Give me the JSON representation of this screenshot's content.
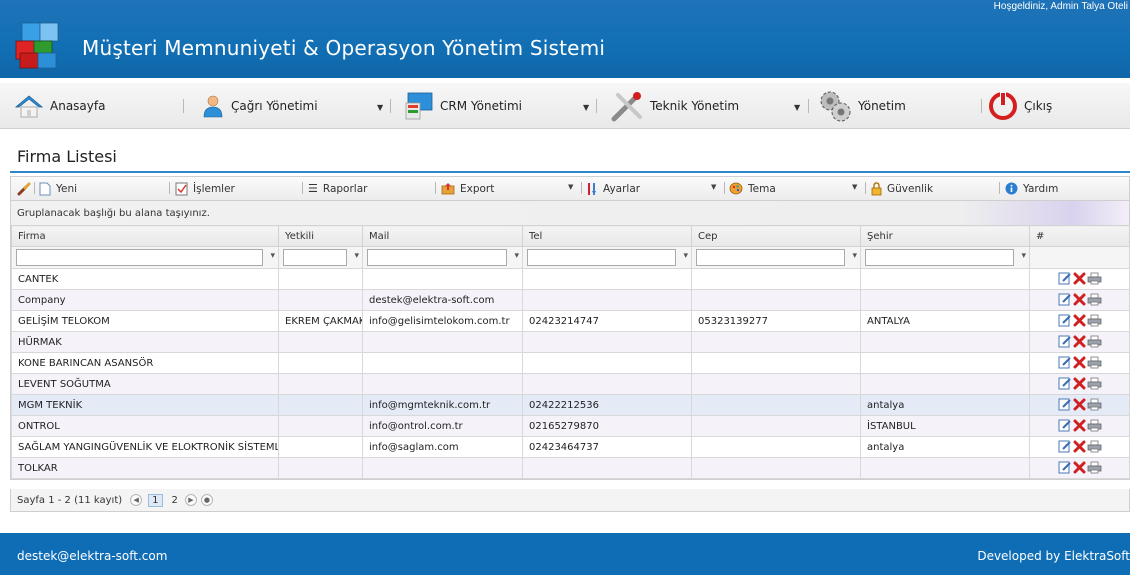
{
  "header": {
    "welcome": "Hoşgeldiniz, Admin Talya Oteli",
    "title": "Müşteri Memnuniyeti & Operasyon Yönetim Sistemi"
  },
  "nav": {
    "home": "Anasayfa",
    "calls": "Çağrı Yönetimi",
    "crm": "CRM Yönetimi",
    "technical": "Teknik Yönetim",
    "admin": "Yönetim",
    "logout": "Çıkış"
  },
  "page": {
    "title": "Firma Listesi"
  },
  "toolbar": {
    "new": "Yeni",
    "operations": "İşlemler",
    "reports": "Raporlar",
    "export": "Export",
    "settings": "Ayarlar",
    "theme": "Tema",
    "security": "Güvenlik",
    "help": "Yardım"
  },
  "grid": {
    "group_hint": "Gruplanacak başlığı bu alana taşıyınız.",
    "columns": [
      "Firma",
      "Yetkili",
      "Mail",
      "Tel",
      "Cep",
      "Şehir",
      "#"
    ],
    "rows": [
      [
        "CANTEK",
        "",
        "",
        "",
        "",
        ""
      ],
      [
        "Company",
        "",
        "destek@elektra-soft.com",
        "",
        "",
        ""
      ],
      [
        "GELİŞİM TELOKOM",
        "EKREM ÇAKMAK",
        "info@gelisimtelokom.com.tr",
        "02423214747",
        "05323139277",
        "ANTALYA"
      ],
      [
        "HÜRMAK",
        "",
        "",
        "",
        "",
        ""
      ],
      [
        "KONE BARINCAN ASANSÖR",
        "",
        "",
        "",
        "",
        ""
      ],
      [
        "LEVENT SOĞUTMA",
        "",
        "",
        "",
        "",
        ""
      ],
      [
        "MGM TEKNİK",
        "",
        "info@mgmteknik.com.tr",
        "02422212536",
        "",
        "antalya"
      ],
      [
        "ONTROL",
        "",
        "info@ontrol.com.tr",
        "02165279870",
        "",
        "İSTANBUL"
      ],
      [
        "SAĞLAM YANGINGÜVENLİK VE ELOKTRONİK SİSTEMLERİ",
        "",
        "info@saglam.com",
        "02423464737",
        "",
        "antalya"
      ],
      [
        "TOLKAR",
        "",
        "",
        "",
        "",
        ""
      ]
    ],
    "selected_row": 6
  },
  "pager": {
    "summary": "Sayfa 1 - 2 (11 kayıt)",
    "pages": [
      "1",
      "2"
    ],
    "current": "1"
  },
  "footer": {
    "email": "destek@elektra-soft.com",
    "credit": "Developed by ElektraSoft"
  },
  "colors": {
    "header_blue": "#126fb4",
    "accent_line": "#2e86c9",
    "delete_red": "#d11f1f"
  }
}
